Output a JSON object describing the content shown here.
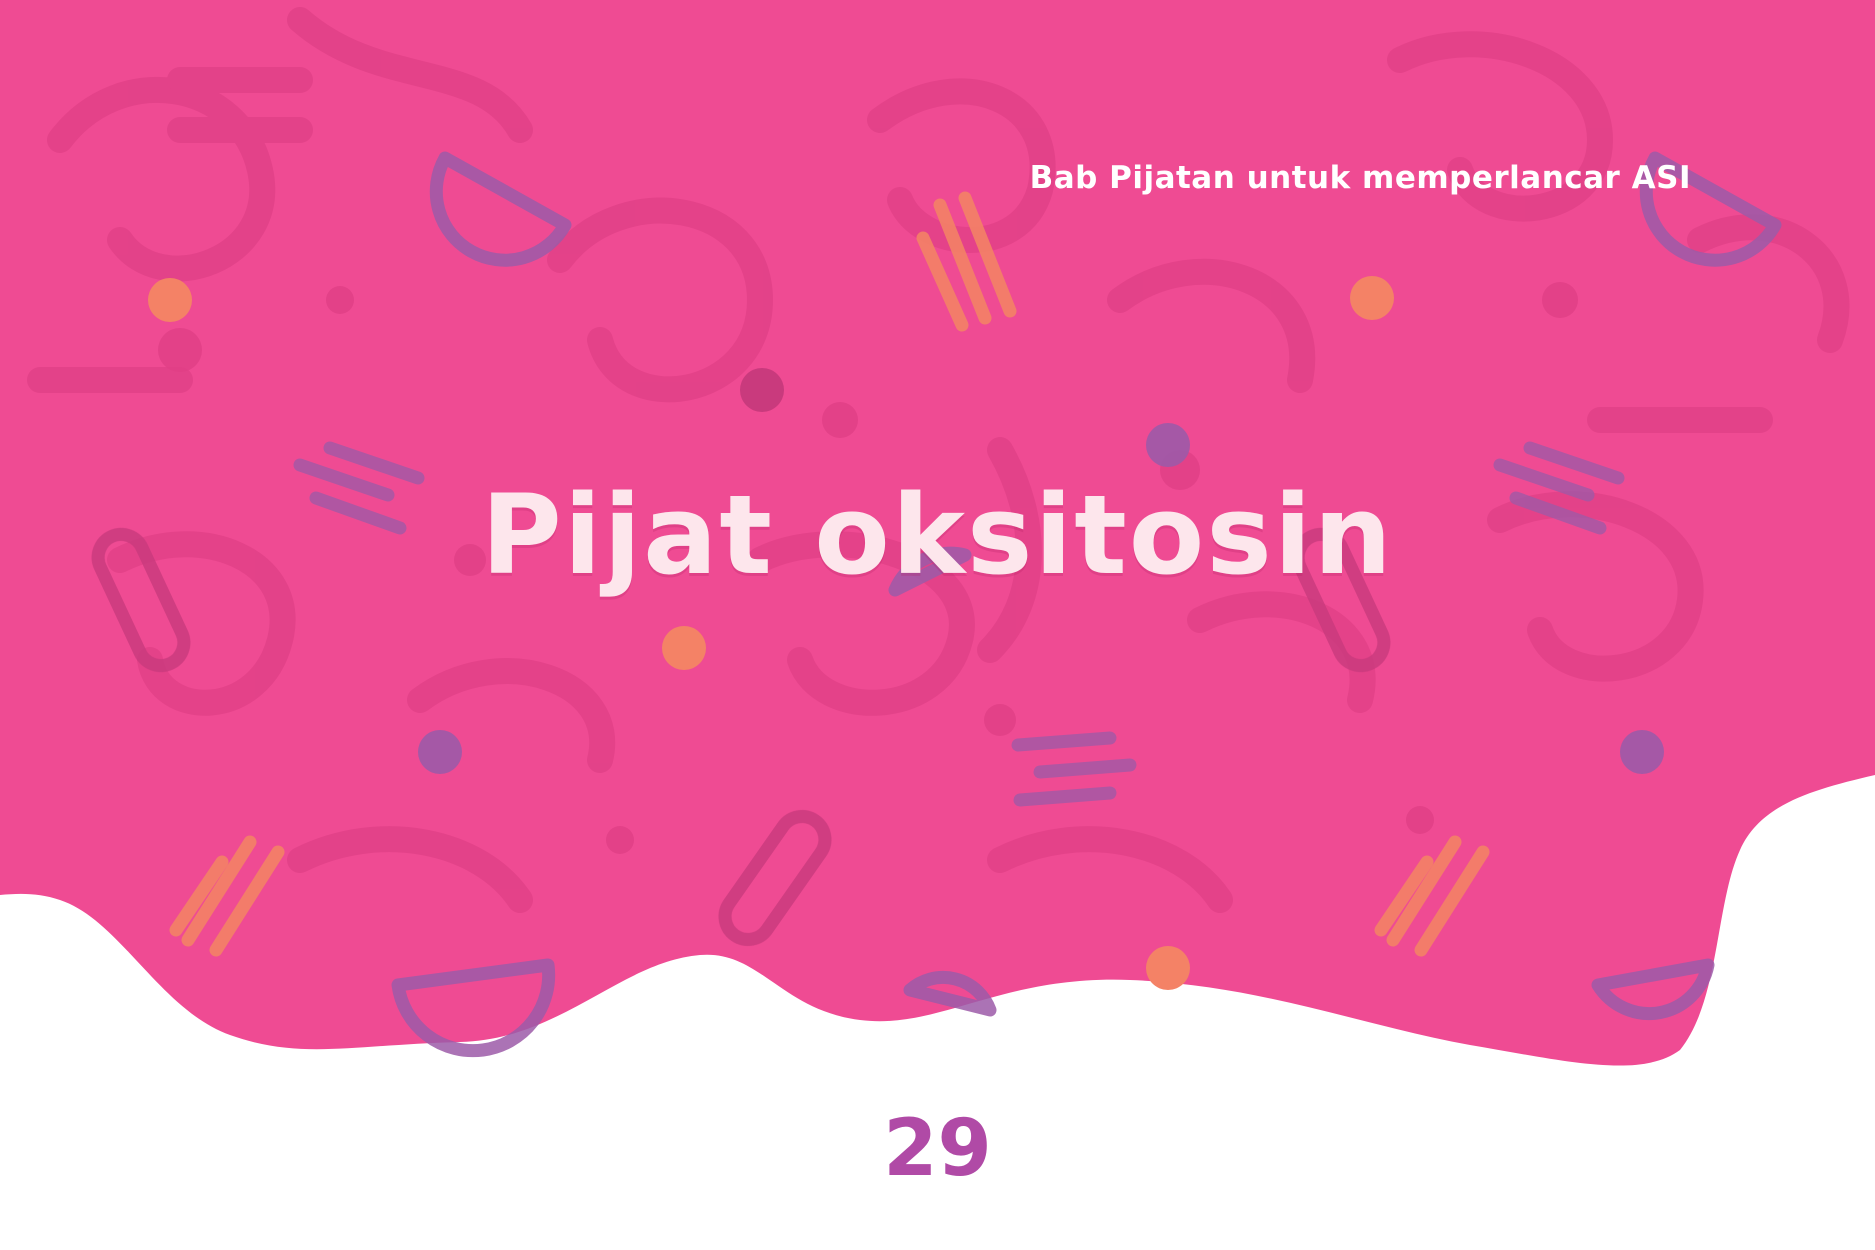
{
  "header": {
    "chapter_label": "Bab Pijatan untuk memperlancar ASI"
  },
  "main": {
    "title": "Pijat oksitosin"
  },
  "footer": {
    "page_number": "29"
  },
  "colors": {
    "background_pink": "#ef4b93",
    "pattern_pink": "#e23f87",
    "title_text": "#fde6ec",
    "chapter_text": "#ffffff",
    "page_number": "#b04aa6",
    "accent_orange": "#f48266",
    "accent_purple": "#9c5aa8"
  }
}
